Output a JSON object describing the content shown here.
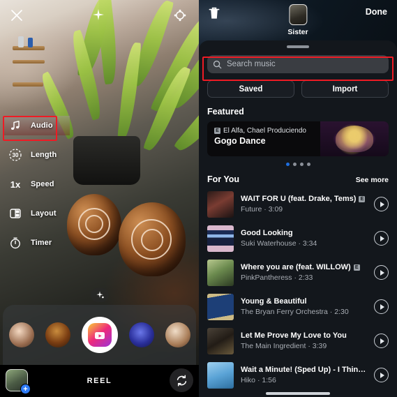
{
  "camera": {
    "close_icon": "close-x-icon",
    "effects_icon": "sparkle-icon",
    "flash_icon": "flash-settings-icon",
    "tools": [
      {
        "label": "Audio",
        "icon": "music-note-icon",
        "badge": ""
      },
      {
        "label": "Length",
        "icon": "duration-icon",
        "badge": "30"
      },
      {
        "label": "Speed",
        "icon": "speed-icon",
        "badge": "1x"
      },
      {
        "label": "Layout",
        "icon": "layout-grid-icon",
        "badge": ""
      },
      {
        "label": "Timer",
        "icon": "timer-icon",
        "badge": ""
      }
    ],
    "mode_label": "REEL",
    "gallery_plus": "+",
    "flip_icon": "flip-camera-icon",
    "ar_icon": "ar-effects-icon"
  },
  "music": {
    "trash_icon": "trash-icon",
    "clip_name": "Sister",
    "done_label": "Done",
    "search": {
      "placeholder": "Search music",
      "icon": "search-icon"
    },
    "segments": [
      {
        "label": "Saved"
      },
      {
        "label": "Import"
      }
    ],
    "featured": {
      "title": "Featured",
      "artist": "El Alfa, Chael Produciendo",
      "explicit": "E",
      "song": "Gogo Dance",
      "dots": 4,
      "active_dot": 0
    },
    "for_you": {
      "title": "For You",
      "see_more": "See more",
      "tracks": [
        {
          "title": "WAIT FOR U (feat. Drake, Tems)",
          "explicit": true,
          "artist": "Future",
          "duration": "3:09",
          "art": "art-wait-for-u"
        },
        {
          "title": "Good Looking",
          "explicit": false,
          "artist": "Suki Waterhouse",
          "duration": "3:34",
          "art": "art-good-looking"
        },
        {
          "title": "Where you are (feat. WILLOW)",
          "explicit": true,
          "artist": "PinkPantheress",
          "duration": "2:33",
          "art": "art-where-you-are"
        },
        {
          "title": "Young & Beautiful",
          "explicit": false,
          "artist": "The Bryan Ferry Orchestra",
          "duration": "2:30",
          "art": "art-young-beautiful"
        },
        {
          "title": "Let Me Prove My Love to You",
          "explicit": false,
          "artist": "The Main Ingredient",
          "duration": "3:39",
          "art": "art-let-me-prove"
        },
        {
          "title": "Wait a Minute! (Sped Up) - I Think I Lef…",
          "explicit": false,
          "artist": "Hiko",
          "duration": "1:56",
          "art": "art-wait-a-minute"
        }
      ]
    },
    "explicit_badge": "E"
  },
  "highlights": {
    "color": "#ef1b24",
    "targets": [
      "audio-tool",
      "search-music-field"
    ]
  }
}
